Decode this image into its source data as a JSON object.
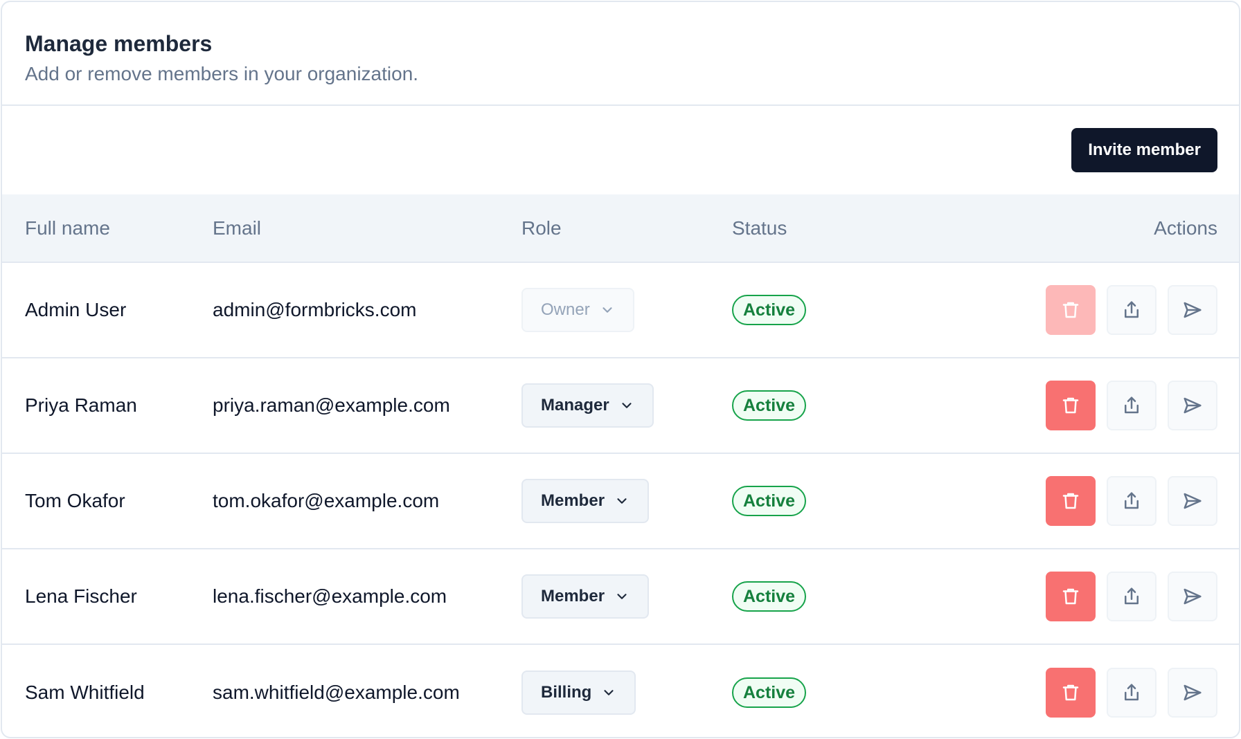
{
  "header": {
    "title": "Manage members",
    "subtitle": "Add or remove members in your organization."
  },
  "toolbar": {
    "invite_label": "Invite member"
  },
  "table": {
    "columns": [
      "Full name",
      "Email",
      "Role",
      "Status",
      "Actions"
    ],
    "rows": [
      {
        "name": "Admin User",
        "email": "admin@formbricks.com",
        "role": "Owner",
        "role_disabled": true,
        "status": "Active",
        "delete_disabled": true
      },
      {
        "name": "Priya Raman",
        "email": "priya.raman@example.com",
        "role": "Manager",
        "role_disabled": false,
        "status": "Active",
        "delete_disabled": false
      },
      {
        "name": "Tom Okafor",
        "email": "tom.okafor@example.com",
        "role": "Member",
        "role_disabled": false,
        "status": "Active",
        "delete_disabled": false
      },
      {
        "name": "Lena Fischer",
        "email": "lena.fischer@example.com",
        "role": "Member",
        "role_disabled": false,
        "status": "Active",
        "delete_disabled": false
      },
      {
        "name": "Sam Whitfield",
        "email": "sam.whitfield@example.com",
        "role": "Billing",
        "role_disabled": false,
        "status": "Active",
        "delete_disabled": false
      }
    ]
  },
  "icons": {
    "delete": "trash-icon",
    "share": "share-upload-icon",
    "send": "send-icon",
    "role_dropdown": "chevron-down-icon"
  },
  "colors": {
    "primary": "#0f172a",
    "danger": "#f87171",
    "success": "#16a34a",
    "muted": "#64748b"
  }
}
